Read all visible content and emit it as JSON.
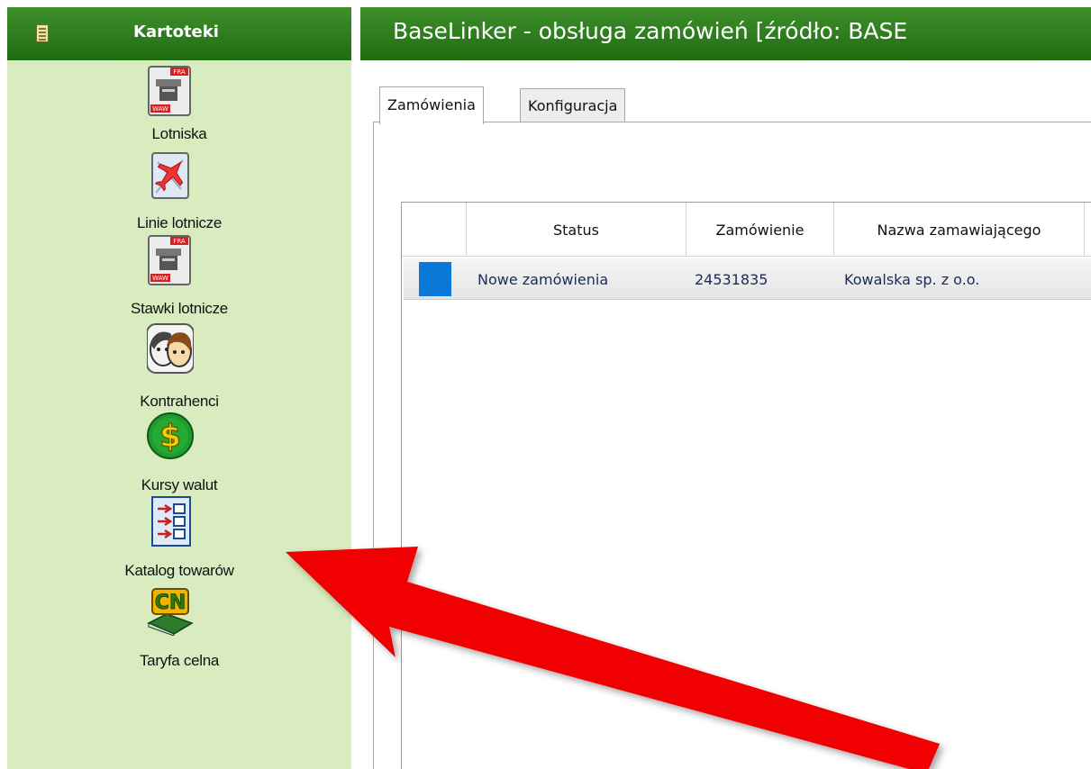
{
  "colors": {
    "header_green": "#2f7e1f",
    "sidebar_bg": "#d8ecbf",
    "selection_marker": "#0a78d6",
    "arrow_red": "#f00000"
  },
  "sidebar": {
    "title": "Kartoteki",
    "header_icon": "list-icon",
    "items": [
      {
        "label": "Lotniska",
        "icon": "airport-fra-waw-icon"
      },
      {
        "label": "Linie lotnicze",
        "icon": "airplane-map-icon"
      },
      {
        "label": "Stawki lotnicze",
        "icon": "airport-fra-waw-icon"
      },
      {
        "label": "Kontrahenci",
        "icon": "people-icon"
      },
      {
        "label": "Kursy walut",
        "icon": "dollar-coin-icon"
      },
      {
        "label": "Katalog towarów",
        "icon": "catalog-list-icon"
      },
      {
        "label": "Taryfa celna",
        "icon": "cn-book-icon"
      }
    ]
  },
  "main": {
    "title": "BaseLinker - obsługa zamówień [źródło: BASE",
    "tabs": [
      {
        "label": "Zamówienia",
        "active": true
      },
      {
        "label": "Konfiguracja",
        "active": false
      }
    ],
    "grid": {
      "columns": [
        "",
        "Status",
        "Zamówienie",
        "Nazwa zamawiającego"
      ],
      "rows": [
        {
          "status": "Nowe zamówienia",
          "order": "24531835",
          "customer": "Kowalska sp. z o.o."
        }
      ]
    }
  },
  "annotation": {
    "type": "arrow",
    "color": "#f00000",
    "points_to": "Katalog towarów"
  }
}
